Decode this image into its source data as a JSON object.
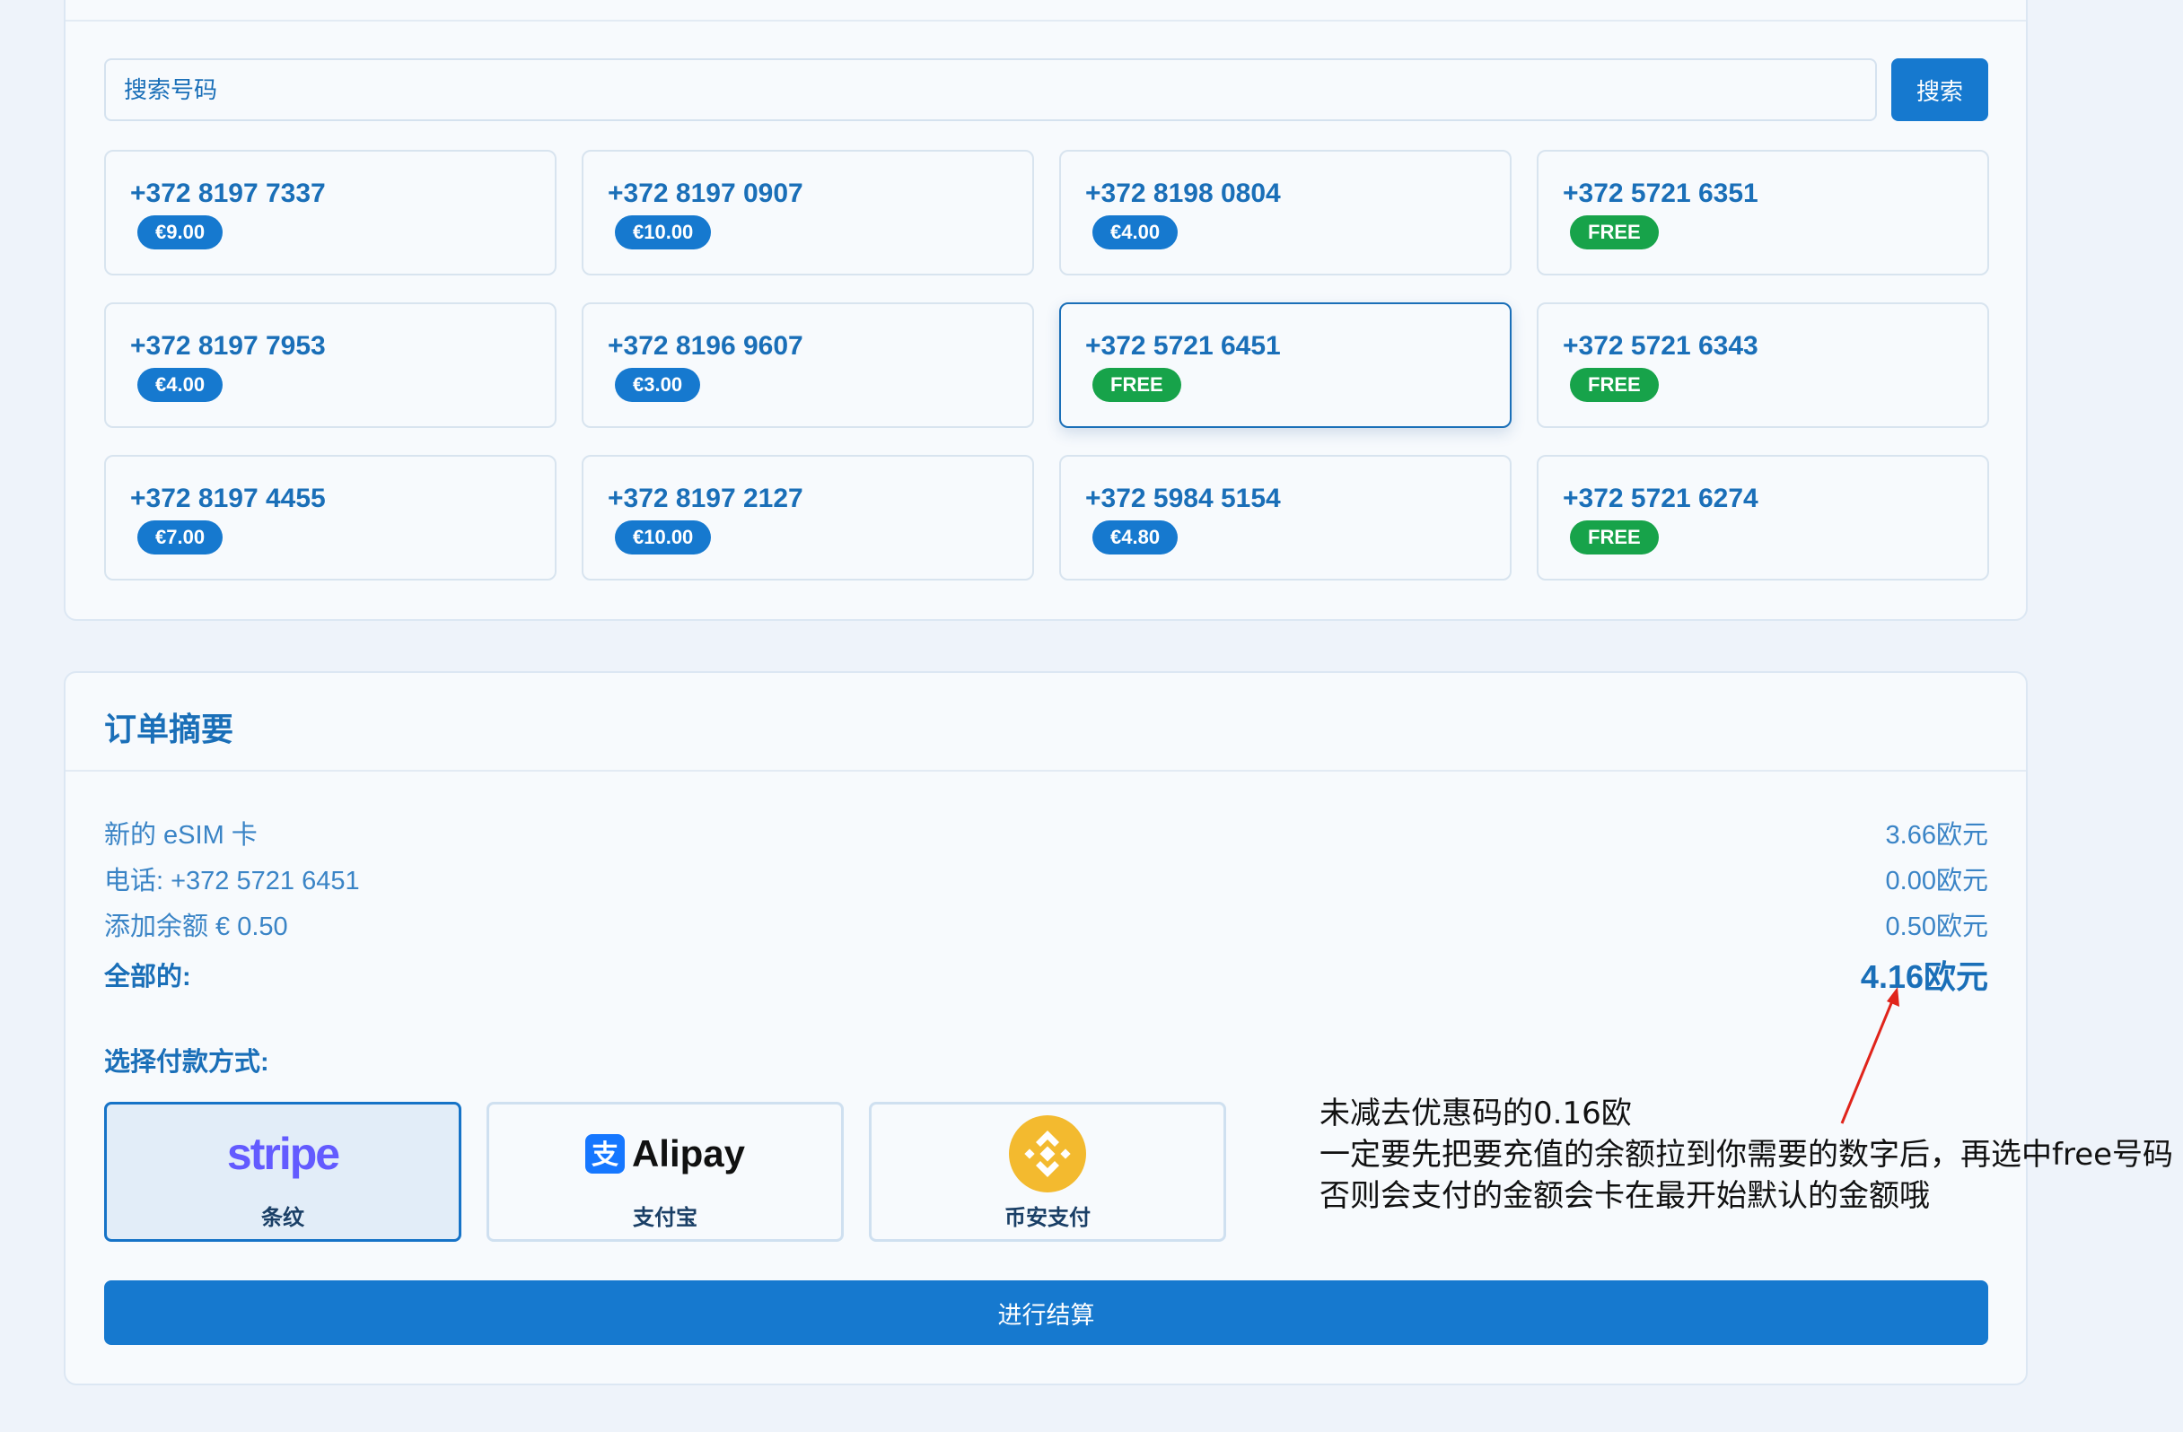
{
  "search": {
    "placeholder": "搜索号码",
    "button_label": "搜索"
  },
  "numbers": [
    {
      "number": "+372 8197 7337",
      "price": "€9.00",
      "free": false
    },
    {
      "number": "+372 8197 0907",
      "price": "€10.00",
      "free": false
    },
    {
      "number": "+372 8198 0804",
      "price": "€4.00",
      "free": false
    },
    {
      "number": "+372 5721 6351",
      "price": "FREE",
      "free": true
    },
    {
      "number": "+372 8197 7953",
      "price": "€4.00",
      "free": false
    },
    {
      "number": "+372 8196 9607",
      "price": "€3.00",
      "free": false
    },
    {
      "number": "+372 5721 6451",
      "price": "FREE",
      "free": true,
      "selected": true
    },
    {
      "number": "+372 5721 6343",
      "price": "FREE",
      "free": true
    },
    {
      "number": "+372 8197 4455",
      "price": "€7.00",
      "free": false
    },
    {
      "number": "+372 8197 2127",
      "price": "€10.00",
      "free": false
    },
    {
      "number": "+372 5984 5154",
      "price": "€4.80",
      "free": false
    },
    {
      "number": "+372 5721 6274",
      "price": "FREE",
      "free": true
    }
  ],
  "summary": {
    "title": "订单摘要",
    "lines": [
      {
        "label": "新的 eSIM 卡",
        "value": "3.66欧元"
      },
      {
        "label": "电话: +372 5721 6451",
        "value": "0.00欧元"
      },
      {
        "label": "添加余额 € 0.50",
        "value": "0.50欧元"
      }
    ],
    "total_label": "全部的:",
    "total_value": "4.16欧元"
  },
  "payment": {
    "title": "选择付款方式:",
    "options": [
      {
        "logo_text": "stripe",
        "label": "条纹",
        "selected": true,
        "icon": "stripe-logo"
      },
      {
        "logo_text": "Alipay",
        "label": "支付宝",
        "selected": false,
        "icon": "alipay-logo"
      },
      {
        "logo_text": "",
        "label": "币安支付",
        "selected": false,
        "icon": "binance-logo"
      }
    ]
  },
  "checkout_label": "进行结算",
  "annotation": {
    "lines": [
      "未减去优惠码的0.16欧",
      "一定要先把要充值的余额拉到你需要的数字后，再选中free号码",
      "否则会支付的金额会卡在最开始默认的金额哦"
    ],
    "color": "#e0241b"
  },
  "colors": {
    "primary": "#1679cf",
    "free_badge": "#17a34a",
    "page_bg": "#eef3fa"
  }
}
